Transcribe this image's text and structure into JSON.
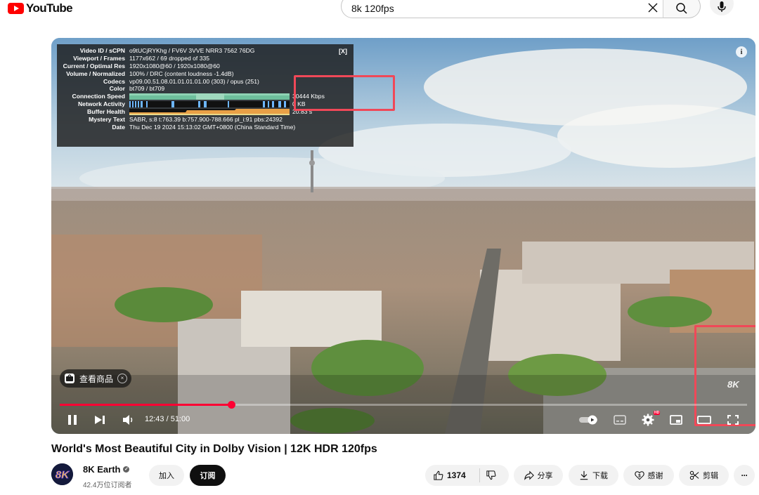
{
  "masthead": {
    "logo_text": "YouTube",
    "search_value": "8k 120fps",
    "icons": {
      "clear": "close-icon",
      "search": "search-icon",
      "voice": "mic-icon"
    }
  },
  "player": {
    "stats": {
      "close_label": "[X]",
      "rows": [
        {
          "key": "Video ID / sCPN",
          "value": "o9tUCjRYKhg  /  FV6V  3VVE  NRR3  7562  76DG"
        },
        {
          "key": "Viewport / Frames",
          "value": "1177x662 / 69 dropped of 335"
        },
        {
          "key": "Current / Optimal Res",
          "value": "1920x1080@60 / 1920x1080@60"
        },
        {
          "key": "Volume / Normalized",
          "value": "100% / DRC (content loudness -1.4dB)"
        },
        {
          "key": "Codecs",
          "value": "vp09.00.51.08.01.01.01.01.00 (303) / opus (251)"
        },
        {
          "key": "Color",
          "value": "bt709 / bt709"
        },
        {
          "key": "Connection Speed",
          "value": "30444 Kbps"
        },
        {
          "key": "Network Activity",
          "value": "0 KB"
        },
        {
          "key": "Buffer Health",
          "value": "20.83 s"
        },
        {
          "key": "Mystery Text",
          "value": "SABR, s:8 t:763.39 b:757.900-788.666 pl_i:91 pbs:24392"
        },
        {
          "key": "Date",
          "value": "Thu Dec 19 2024 15:13:02 GMT+0800 (China Standard Time)"
        }
      ]
    },
    "shopping_chip": {
      "label": "查看商品"
    },
    "watermark": "8K",
    "time_display": "12:43 / 51:00",
    "progress_fraction": 0.249,
    "hd_badge": "HD",
    "accent_color": "#ff0033",
    "highlight_color": "#f04858"
  },
  "video": {
    "title": "World's Most Beautiful City in Dolby Vision | 12K HDR 120fps",
    "channel": {
      "name": "8K Earth",
      "avatar_text": "8K",
      "subscribers": "42.4万位订阅者"
    },
    "buttons": {
      "join": "加入",
      "subscribe": "订阅",
      "like_count": "1374",
      "share": "分享",
      "download": "下载",
      "thanks": "感谢",
      "clip": "剪辑",
      "more": "···"
    }
  }
}
